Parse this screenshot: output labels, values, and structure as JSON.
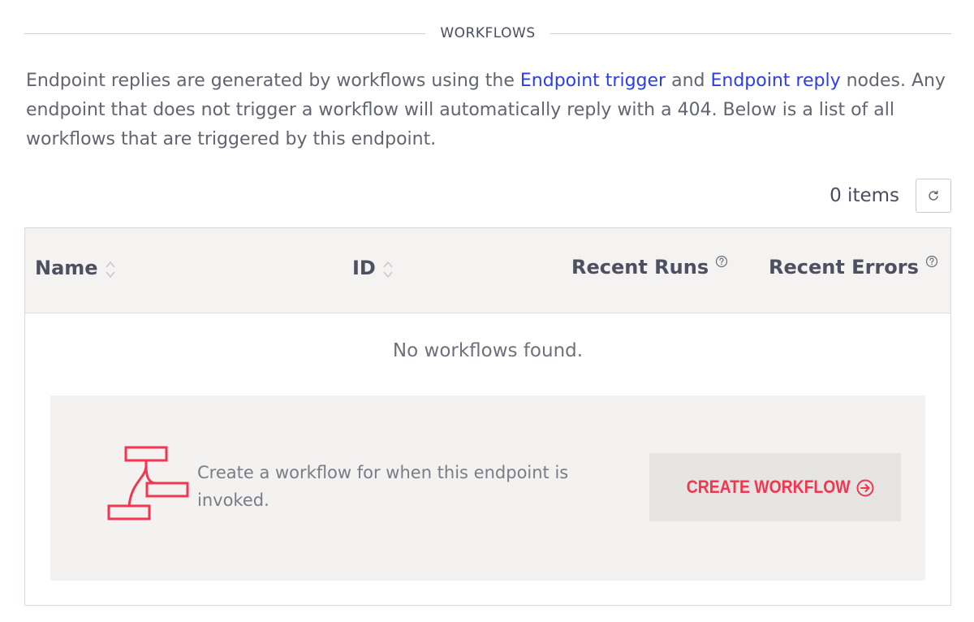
{
  "section": {
    "title": "WORKFLOWS"
  },
  "description": {
    "part1": "Endpoint replies are generated by workflows using the ",
    "link1": "Endpoint trigger",
    "part2": " and ",
    "link2": "Endpoint reply",
    "part3": " nodes. Any endpoint that does not trigger a workflow will automatically reply with a 404. Below is a list of all workflows that are triggered by this endpoint."
  },
  "toolbar": {
    "item_count": "0 items",
    "refresh_icon": "refresh-icon"
  },
  "table": {
    "columns": [
      {
        "label": "Name",
        "sortable": true
      },
      {
        "label": "ID",
        "sortable": true
      },
      {
        "label": "Recent Runs",
        "help": true
      },
      {
        "label": "Recent Errors",
        "help": true
      }
    ],
    "empty_message": "No workflows found."
  },
  "cta": {
    "icon": "workflow-icon",
    "text": "Create a workflow for when this endpoint is invoked.",
    "button_label": "CREATE WORKFLOW",
    "button_icon": "arrow-circle-right-icon"
  },
  "colors": {
    "link": "#2b3ee8",
    "accent": "#f0374f",
    "header_bg": "#f4f3f2",
    "panel_bg": "#f3f2f1"
  }
}
